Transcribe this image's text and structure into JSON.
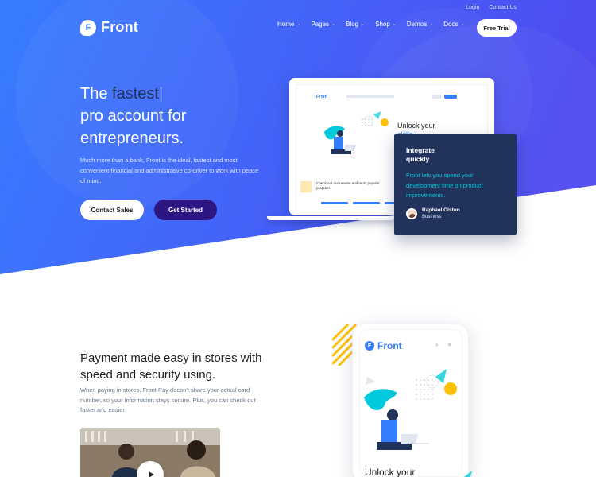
{
  "colors": {
    "hero_gradient_start": "#377dff",
    "hero_gradient_end": "#4f4bf0",
    "accent_dark": "#21325b",
    "accent_purple": "#2d1582",
    "accent_cyan": "#00c9db",
    "accent_yellow": "#ffc107",
    "text_muted": "#677788"
  },
  "topbar": {
    "login": "Login",
    "contact": "Contact Us"
  },
  "brand": {
    "logo_letter": "F",
    "name": "Front"
  },
  "nav": {
    "items": [
      "Home",
      "Pages",
      "Blog",
      "Shop",
      "Demos",
      "Docs"
    ],
    "cta": "Free Trial"
  },
  "hero": {
    "title_prefix": "The",
    "title_accent": "fastest",
    "title_caret": "|",
    "title_line2": "pro account for",
    "title_line3": "entrepreneurs.",
    "description": "Much more than a bank, Front is the ideal, fastest and most convenient financial and administrative co-driver to work with peace of mind.",
    "btn_contact": "Contact Sales",
    "btn_start": "Get Started"
  },
  "laptop_preview": {
    "logo": "Front",
    "title_line1": "Unlock your",
    "title_line2": "skills |",
    "card_text": "Check out our newest and most popular program"
  },
  "callout": {
    "title": "Integrate quickly",
    "description": "Front lets you spend your development time on product improvements.",
    "author_name": "Raphael Olston",
    "author_role": "Business"
  },
  "section": {
    "title": "Payment made easy in stores with speed and security using.",
    "description": "When paying in stores, Front Pay doesn't share your actual card number, so your information stays secure. Plus, you can check out faster and easier."
  },
  "phone_preview": {
    "logo_letter": "F",
    "logo": "Front",
    "search_icon": "search-icon",
    "menu_icon": "menu-icon",
    "title": "Unlock your"
  }
}
